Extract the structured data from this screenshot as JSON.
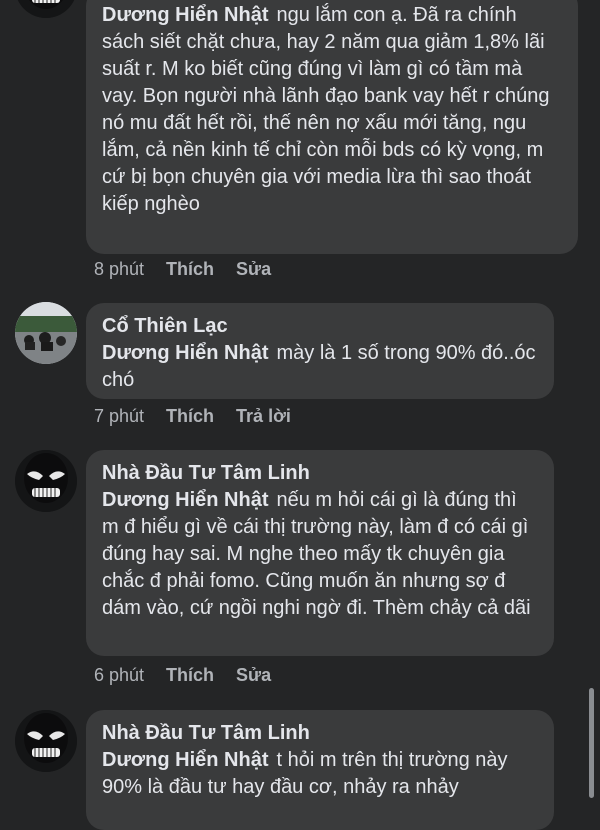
{
  "comments": [
    {
      "author": "",
      "tag": "Dương Hiển Nhật",
      "text": "ngu lắm con ạ. Đã ra chính sách siết chặt chưa, hay 2 năm qua giảm 1,8% lãi suất r. M ko biết cũng đúng vì làm gì có tầm mà vay. Bọn người nhà lãnh đạo bank vay hết r chúng nó mu đất hết rồi, thế nên nợ xấu mới tăng, ngu lắm, cả nền kinh tế chỉ còn mỗi bds có kỳ vọng, m cứ bị bọn chuyên gia với media lừa thì sao thoát kiếp nghèo",
      "time": "8 phút",
      "like": "Thích",
      "second_action": "Sửa"
    },
    {
      "author": "Cổ Thiên Lạc",
      "tag": "Dương Hiển Nhật",
      "text": "mày là 1 số trong 90% đó..óc chó",
      "time": "7 phút",
      "like": "Thích",
      "second_action": "Trả lời"
    },
    {
      "author": "Nhà Đầu Tư Tâm Linh",
      "tag": "Dương Hiển Nhật",
      "text": "nếu m hỏi cái gì là đúng thì m đ hiểu gì về cái thị trường này, làm đ có cái gì đúng hay sai. M nghe theo mấy tk chuyên gia chắc đ phải fomo. Cũng muốn ăn nhưng sợ đ dám vào, cứ ngồi nghi ngờ đi. Thèm chảy cả dãi",
      "time": "6 phút",
      "like": "Thích",
      "second_action": "Sửa"
    },
    {
      "author": "Nhà Đầu Tư Tâm Linh",
      "tag": "Dương Hiển Nhật",
      "text": "t hỏi m trên thị trường này 90% là đầu tư hay đầu cơ, nhảy ra nhảy",
      "time": "",
      "like": "",
      "second_action": ""
    }
  ],
  "avatars": [
    "skull-mask-avatar",
    "street-photo-avatar",
    "skull-mask-avatar",
    "skull-mask-avatar"
  ]
}
